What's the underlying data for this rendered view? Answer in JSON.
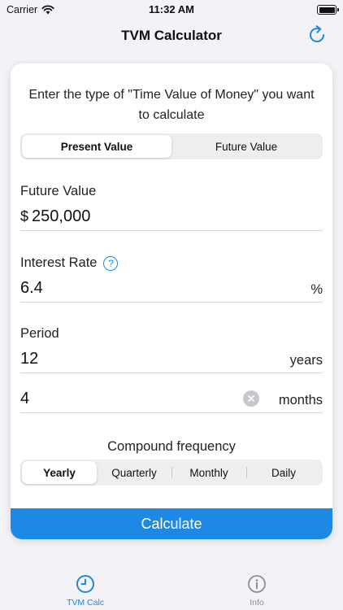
{
  "status_bar": {
    "carrier": "Carrier",
    "time": "11:32 AM"
  },
  "nav": {
    "title": "TVM Calculator",
    "refresh_icon": "refresh-icon"
  },
  "prompt": "Enter the type of \"Time Value of Money\" you want to calculate",
  "calc_type": {
    "options": [
      "Present Value",
      "Future Value"
    ],
    "selected": "Present Value"
  },
  "future_value": {
    "label": "Future Value",
    "currency": "$",
    "value": "250,000"
  },
  "interest_rate": {
    "label": "Interest Rate",
    "help_icon": "question-circle-icon",
    "help_glyph": "?",
    "value": "6.4",
    "unit": "%"
  },
  "period": {
    "label": "Period",
    "years_value": "12",
    "years_unit": "years",
    "months_value": "4",
    "months_unit": "months"
  },
  "compound": {
    "label": "Compound frequency",
    "options": [
      "Yearly",
      "Quarterly",
      "Monthly",
      "Daily"
    ],
    "selected": "Yearly"
  },
  "calculate_label": "Calculate",
  "tabs": [
    {
      "label": "TVM Calc",
      "icon": "clock-icon",
      "active": true
    },
    {
      "label": "Info",
      "icon": "info-icon",
      "active": false
    }
  ],
  "colors": {
    "accent": "#1E88E5",
    "background": "#F2F2F7",
    "inactive_tab": "#8E8E93"
  }
}
